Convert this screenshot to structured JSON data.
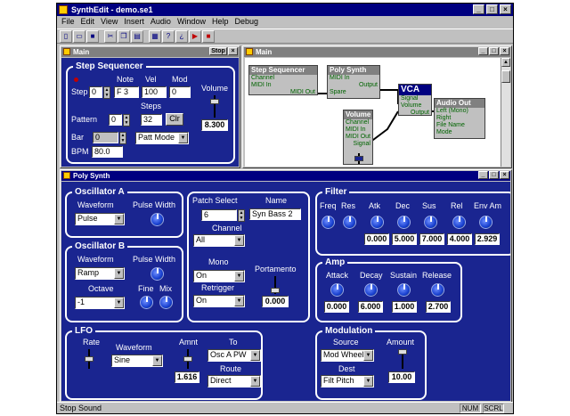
{
  "app": {
    "title": "SynthEdit - demo.se1"
  },
  "menu": [
    "File",
    "Edit",
    "View",
    "Insert",
    "Audio",
    "Window",
    "Help",
    "Debug"
  ],
  "toolbar_icons": [
    "new-icon",
    "open-icon",
    "save-icon",
    "cut-icon",
    "copy-icon",
    "paste-icon",
    "print-icon",
    "help-icon",
    "context-help-icon",
    "play-icon",
    "stop-icon"
  ],
  "main_small": {
    "title": "Main",
    "stop_label": "Stop",
    "seq": {
      "title": "Step Sequencer",
      "note_h": "Note",
      "vel_h": "Vel",
      "mod_h": "Mod",
      "step_l": "Step",
      "step_v": "0",
      "note_v": "F 3",
      "vel_v": "100",
      "mod_v": "0",
      "steps_l": "Steps",
      "pattern_l": "Pattern",
      "pattern_v": "0",
      "steps_v": "32",
      "clr": "Clr",
      "bar_l": "Bar",
      "bar_v": "0",
      "mode_v": "Patt Mode",
      "bpm_l": "BPM",
      "bpm_v": "80.0",
      "volume_l": "Volume",
      "volume_v": "8.300",
      "volume_level": 0.8
    }
  },
  "main_canvas": {
    "title": "Main",
    "modules": {
      "seq": {
        "title": "Step Sequencer",
        "p1": "Channel",
        "p2": "MIDI In",
        "p3": "MIDI Out"
      },
      "poly": {
        "title": "Poly Synth",
        "p1": "MIDI In",
        "p2": "Output",
        "p3": "Spare"
      },
      "vca": {
        "title": "VCA",
        "p1": "Signal",
        "p2": "Volume",
        "p3": "Output"
      },
      "audio": {
        "title": "Audio Out",
        "p1": "Left (Mono)",
        "p2": "Right",
        "p3": "File Name",
        "p4": "Mode"
      },
      "volume": {
        "title": "Volume",
        "p1": "Channel",
        "p2": "MIDI In",
        "p3": "MIDI Out",
        "p4": "Signal"
      }
    }
  },
  "poly": {
    "title": "Poly Synth",
    "oscA": {
      "title": "Oscillator A",
      "waveform_l": "Waveform",
      "waveform_v": "Pulse",
      "pw_l": "Pulse Width"
    },
    "oscB": {
      "title": "Oscillator B",
      "waveform_l": "Waveform",
      "waveform_v": "Ramp",
      "pw_l": "Pulse Width",
      "octave_l": "Octave",
      "octave_v": "-1",
      "fine_l": "Fine",
      "mix_l": "Mix"
    },
    "patch": {
      "select_l": "Patch Select",
      "select_v": "6",
      "name_l": "Name",
      "name_v": "Syn Bass 2",
      "channel_l": "Channel",
      "channel_v": "All",
      "mono_l": "Mono",
      "mono_v": "On",
      "retrig_l": "Retrigger",
      "retrig_v": "On",
      "porta_l": "Portamento",
      "porta_v": "0.000",
      "porta_level": 0.05
    },
    "filter": {
      "title": "Filter",
      "labels": [
        "Freq",
        "Res",
        "Atk",
        "Dec",
        "Sus",
        "Rel",
        "Env Am"
      ],
      "values": [
        "0.000",
        "5.000",
        "7.000",
        "4.000",
        "2.929"
      ]
    },
    "amp": {
      "title": "Amp",
      "labels": [
        "Attack",
        "Decay",
        "Sustain",
        "Release"
      ],
      "values": [
        "0.000",
        "6.000",
        "1.000",
        "2.700"
      ]
    },
    "lfo": {
      "title": "LFO",
      "rate_l": "Rate",
      "waveform_l": "Waveform",
      "waveform_v": "Sine",
      "amnt_l": "Amnt",
      "amnt_v": "1.616",
      "amnt_level": 0.5,
      "to_l": "To",
      "to_v": "Osc A PW",
      "route_l": "Route",
      "route_v": "Direct"
    },
    "modulation": {
      "title": "Modulation",
      "source_l": "Source",
      "source_v": "Mod Wheel",
      "amount_l": "Amount",
      "amount_v": "10.00",
      "amount_level": 1.0,
      "dest_l": "Dest",
      "dest_v": "Filt Pitch"
    }
  },
  "status": {
    "text": "Stop Sound",
    "num": "NUM",
    "scrl": "SCRL"
  }
}
